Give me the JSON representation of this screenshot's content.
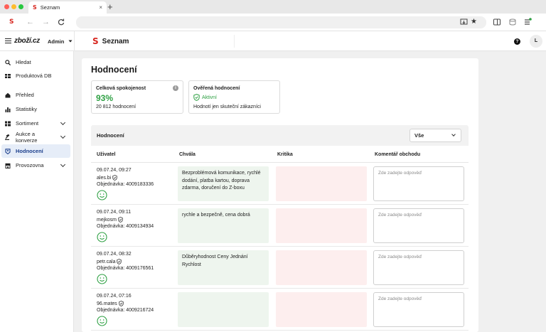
{
  "browser": {
    "tab_title": "Seznam",
    "tab_close": "×",
    "new_tab": "+",
    "tab_logo": "S"
  },
  "header": {
    "brand": "zboží.cz",
    "admin_label": "Admin",
    "app_logo": "S",
    "app_title": "Seznam",
    "help": "?",
    "avatar": "L"
  },
  "sidebar": {
    "items": [
      {
        "label": "Hledat",
        "icon": "search-icon"
      },
      {
        "label": "Produktová DB",
        "icon": "database-icon"
      },
      {
        "label": "Přehled",
        "icon": "home-icon"
      },
      {
        "label": "Statistiky",
        "icon": "bar-chart-icon"
      },
      {
        "label": "Sortiment",
        "icon": "grid-icon"
      },
      {
        "label": "Aukce a konverze",
        "icon": "gavel-icon"
      },
      {
        "label": "Hodnocení",
        "icon": "rating-icon"
      },
      {
        "label": "Provozovna",
        "icon": "store-icon"
      }
    ]
  },
  "main": {
    "title": "Hodnocení",
    "satisfaction_card": {
      "title": "Celková spokojenost",
      "value": "93%",
      "count": "20 812 hodnocení"
    },
    "verified_card": {
      "title": "Ověřená hodnocení",
      "status": "Aktivní",
      "note": "Hodnotí jen skuteční zákazníci"
    },
    "section": {
      "title": "Hodnocení",
      "filter_value": "Vše",
      "columns": [
        "Uživatel",
        "Chvála",
        "Kritika",
        "Komentář obchodu"
      ],
      "reply_placeholder": "Zde zadejte odpověď",
      "rows": [
        {
          "date": "09.07.24, 09:27",
          "user": "ales.bi",
          "order": "Objednávka: 4009183336",
          "pros": "Bezproblémová komunikace, rychlé dodání, platba kartou, doprava zdarma, doručení do Z-boxu",
          "cons": ""
        },
        {
          "date": "09.07.24, 09:11",
          "user": "mejkosm",
          "order": "Objednávka: 4009134934",
          "pros": "rychle a bezpečně, cena dobrá",
          "cons": ""
        },
        {
          "date": "09.07.24, 08:32",
          "user": "petr.cala",
          "order": "Objednávka: 4009176561",
          "pros": "Důběryhodnost Ceny Jednání Rychlost",
          "cons": ""
        },
        {
          "date": "09.07.24, 07:16",
          "user": "96.mates",
          "order": "Objednávka: 4009216724",
          "pros": "",
          "cons": ""
        }
      ]
    }
  },
  "colors": {
    "accent_green": "#2ea043",
    "brand_red": "#d7261f",
    "active_nav_bg": "#e6edf8",
    "pros_bg": "#eef5ee",
    "cons_bg": "#fdeeee"
  }
}
